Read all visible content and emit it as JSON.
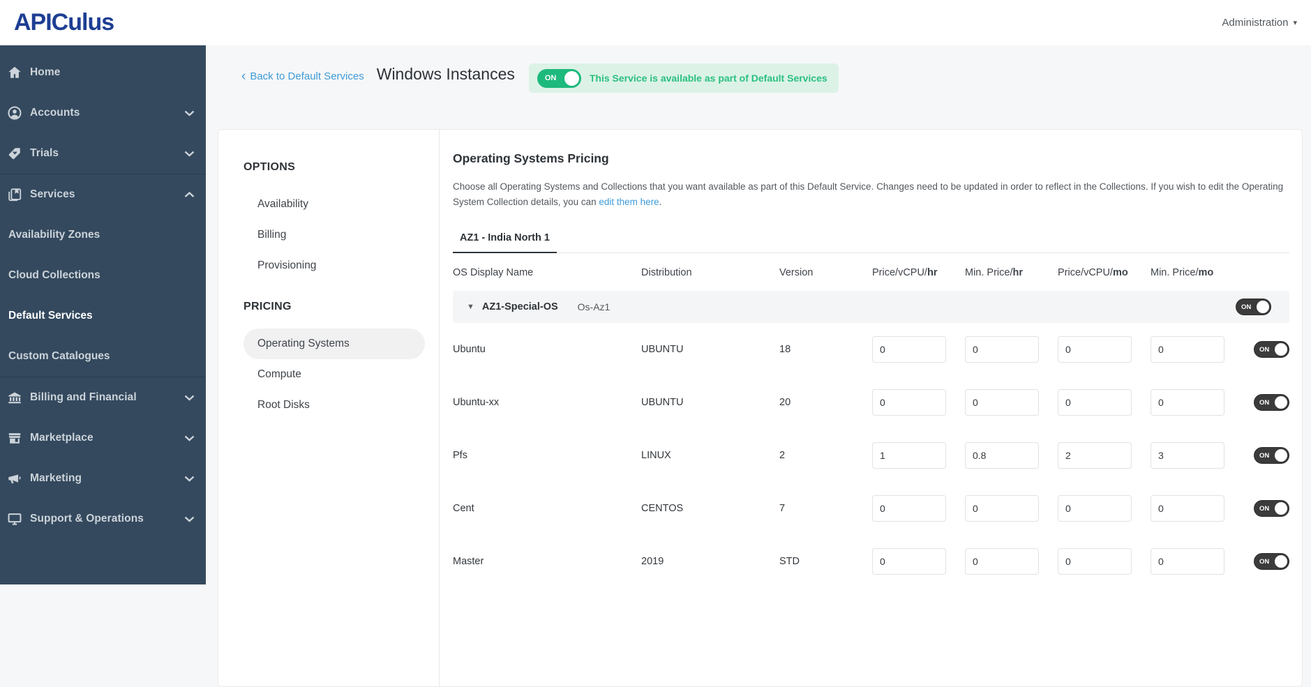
{
  "header": {
    "logo": "APICulus",
    "admin_label": "Administration"
  },
  "sidebar": {
    "items": [
      {
        "label": "Home",
        "icon": "home-icon"
      },
      {
        "label": "Accounts",
        "icon": "user-icon",
        "chevron": "down"
      },
      {
        "label": "Trials",
        "icon": "tag-icon",
        "chevron": "down"
      },
      {
        "label": "Services",
        "icon": "services-icon",
        "chevron": "up"
      },
      {
        "label": "Availability Zones",
        "type": "sub"
      },
      {
        "label": "Cloud Collections",
        "type": "sub"
      },
      {
        "label": "Default Services",
        "type": "sub",
        "active": true
      },
      {
        "label": "Custom Catalogues",
        "type": "sub"
      },
      {
        "label": "Billing and Financial",
        "icon": "bank-icon",
        "chevron": "down"
      },
      {
        "label": "Marketplace",
        "icon": "store-icon",
        "chevron": "down"
      },
      {
        "label": "Marketing",
        "icon": "megaphone-icon",
        "chevron": "down"
      },
      {
        "label": "Support & Operations",
        "icon": "monitor-icon",
        "chevron": "down"
      }
    ]
  },
  "page": {
    "back_label": "Back to Default Services",
    "title": "Windows Instances",
    "badge": {
      "toggle": "ON",
      "text": "This Service is available as part of Default Services"
    }
  },
  "options_menu": {
    "section1_title": "OPTIONS",
    "section1_items": [
      "Availability",
      "Billing",
      "Provisioning"
    ],
    "section2_title": "PRICING",
    "section2_items": [
      "Operating Systems",
      "Compute",
      "Root Disks"
    ],
    "active_item": "Operating Systems"
  },
  "pricing": {
    "heading": "Operating Systems Pricing",
    "description_text": "Choose all Operating Systems and Collections that you want available as part of this Default Service. Changes need to be updated in order to reflect in the Collections. If you wish to edit the Operating System Collection details, you can ",
    "description_link": "edit them here",
    "description_period": ".",
    "tab": "AZ1 - India North 1",
    "columns": [
      {
        "text": "OS Display Name"
      },
      {
        "text": "Distribution"
      },
      {
        "text": "Version"
      },
      {
        "prefix": "Price/vCPU/",
        "unit": "hr"
      },
      {
        "prefix": "Min. Price/",
        "unit": "hr"
      },
      {
        "prefix": "Price/vCPU/",
        "unit": "mo"
      },
      {
        "prefix": "Min. Price/",
        "unit": "mo"
      }
    ],
    "group": {
      "name": "AZ1-Special-OS",
      "sub": "Os-Az1",
      "toggle": "ON"
    },
    "rows": [
      {
        "name": "Ubuntu",
        "distribution": "UBUNTU",
        "version": "18",
        "price_vcpu_hr": "0",
        "min_price_hr": "0",
        "price_vcpu_mo": "0",
        "min_price_mo": "0",
        "toggle": "ON"
      },
      {
        "name": "Ubuntu-xx",
        "distribution": "UBUNTU",
        "version": "20",
        "price_vcpu_hr": "0",
        "min_price_hr": "0",
        "price_vcpu_mo": "0",
        "min_price_mo": "0",
        "toggle": "ON"
      },
      {
        "name": "Pfs",
        "distribution": "LINUX",
        "version": "2",
        "price_vcpu_hr": "1",
        "min_price_hr": "0.8",
        "price_vcpu_mo": "2",
        "min_price_mo": "3",
        "toggle": "ON"
      },
      {
        "name": "Cent",
        "distribution": "CENTOS",
        "version": "7",
        "price_vcpu_hr": "0",
        "min_price_hr": "0",
        "price_vcpu_mo": "0",
        "min_price_mo": "0",
        "toggle": "ON"
      },
      {
        "name": "Master",
        "distribution": "2019",
        "version": "STD",
        "price_vcpu_hr": "0",
        "min_price_hr": "0",
        "price_vcpu_mo": "0",
        "min_price_mo": "0",
        "toggle": "ON"
      }
    ]
  }
}
